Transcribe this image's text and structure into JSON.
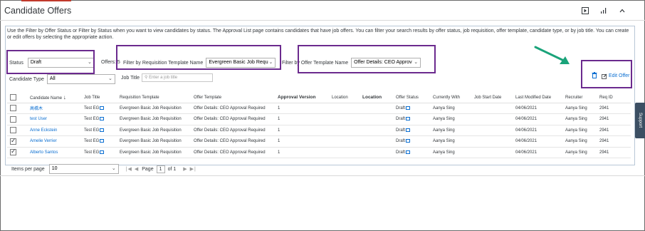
{
  "page": {
    "title": "Candidate Offers",
    "info_text": "Use the Filter by Offer Status or Filter by Status when you want to view candidates by status. The Approval List page contains candidates that have job offers. You can filter your search results by offer status, job requisition, offer template, candidate type, or by job title. You can create or edit offers by selecting the appropriate action."
  },
  "filters": {
    "status_label": "Status",
    "status_value": "Draft",
    "offers_label": "Offers: 5",
    "req_template_label": "Filter by Requisition Template Name",
    "req_template_value": "Evergreen Basic Job Requ",
    "offer_template_label": "Filter by Offer Template Name",
    "offer_template_value": "Offer Details: CEO Approv",
    "candidate_type_label": "Candidate Type",
    "candidate_type_value": "All",
    "job_title_label": "Job Title",
    "job_title_placeholder": "Enter a job title"
  },
  "actions": {
    "edit_offer_label": "Edit Offer"
  },
  "table": {
    "headers": [
      "",
      "Candidate Name",
      "Job Title",
      "Requisition Template",
      "Offer Template",
      "Approval Version",
      "Location",
      "Location",
      "Offer Status",
      "Currently With",
      "Job Start Date",
      "Last Modified Date",
      "Recruiter",
      "Req ID"
    ],
    "rows": [
      {
        "checked": false,
        "name": "高橋木",
        "job_title": "Test EG",
        "req_template": "Evergreen Basic Job Requisition",
        "offer_template": "Offer Details: CEO Approval Required",
        "approval_version": "1",
        "location1": "",
        "location2": "",
        "offer_status": "Draft",
        "currently_with": "Aanya Sing",
        "job_start": "",
        "last_modified": "04/06/2021",
        "recruiter": "Aanya Sing",
        "req_id": "2941"
      },
      {
        "checked": false,
        "name": "test User",
        "job_title": "Test EG",
        "req_template": "Evergreen Basic Job Requisition",
        "offer_template": "Offer Details: CEO Approval Required",
        "approval_version": "1",
        "location1": "",
        "location2": "",
        "offer_status": "Draft",
        "currently_with": "Aanya Sing",
        "job_start": "",
        "last_modified": "04/06/2021",
        "recruiter": "Aanya Sing",
        "req_id": "2941"
      },
      {
        "checked": false,
        "name": "Anne Eckstein",
        "job_title": "Test EG",
        "req_template": "Evergreen Basic Job Requisition",
        "offer_template": "Offer Details: CEO Approval Required",
        "approval_version": "1",
        "location1": "",
        "location2": "",
        "offer_status": "Draft",
        "currently_with": "Aanya Sing",
        "job_start": "",
        "last_modified": "04/06/2021",
        "recruiter": "Aanya Sing",
        "req_id": "2941"
      },
      {
        "checked": true,
        "name": "Amelie Verrier",
        "job_title": "Test EG",
        "req_template": "Evergreen Basic Job Requisition",
        "offer_template": "Offer Details: CEO Approval Required",
        "approval_version": "1",
        "location1": "",
        "location2": "",
        "offer_status": "Draft",
        "currently_with": "Aanya Sing",
        "job_start": "",
        "last_modified": "04/06/2021",
        "recruiter": "Aanya Sing",
        "req_id": "2941"
      },
      {
        "checked": true,
        "name": "Alberto Santos",
        "job_title": "Test EG",
        "req_template": "Evergreen Basic Job Requisition",
        "offer_template": "Offer Details: CEO Approval Required",
        "approval_version": "1",
        "location1": "",
        "location2": "",
        "offer_status": "Draft",
        "currently_with": "Aanya Sing",
        "job_start": "",
        "last_modified": "04/06/2021",
        "recruiter": "Aanya Sing",
        "req_id": "2941"
      }
    ]
  },
  "pager": {
    "items_label": "Items per page",
    "items_value": "10",
    "page_label": "Page",
    "page_value": "1",
    "of_label": "of 1"
  },
  "side": {
    "support_label": "Support"
  },
  "colors": {
    "link": "#0a6ed1",
    "highlight": "#6b2a8e",
    "arrow": "#1aa37a",
    "support_bg": "#3c4f63"
  }
}
